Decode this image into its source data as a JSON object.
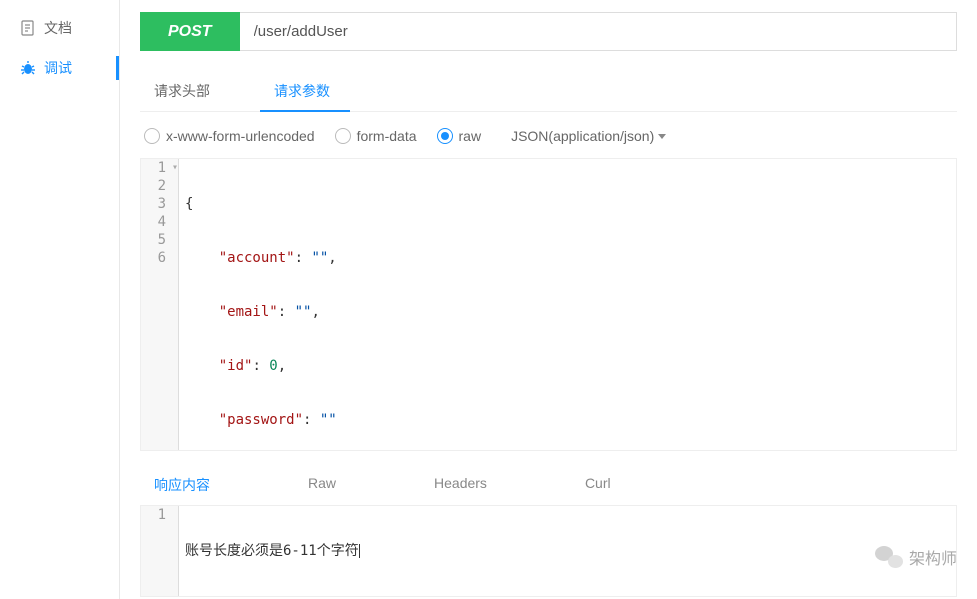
{
  "sidebar": {
    "items": [
      {
        "label": "文档",
        "icon": "document-icon"
      },
      {
        "label": "调试",
        "icon": "debug-icon"
      }
    ]
  },
  "request": {
    "method": "POST",
    "url": "/user/addUser"
  },
  "reqTabs": {
    "headers": "请求头部",
    "params": "请求参数"
  },
  "bodyTypes": {
    "urlencoded": "x-www-form-urlencoded",
    "formdata": "form-data",
    "raw": "raw",
    "contentType": "JSON(application/json)"
  },
  "code": {
    "lines": [
      "{",
      "    \"account\": \"\",",
      "    \"email\": \"\",",
      "    \"id\": 0,",
      "    \"password\": \"\"",
      "}"
    ],
    "gutterNumbers": [
      "1",
      "2",
      "3",
      "4",
      "5",
      "6"
    ]
  },
  "respTabs": {
    "content": "响应内容",
    "raw": "Raw",
    "headers": "Headers",
    "curl": "Curl"
  },
  "response": {
    "gutter": "1",
    "text": "账号长度必须是6-11个字符"
  },
  "watermark": "架构师"
}
